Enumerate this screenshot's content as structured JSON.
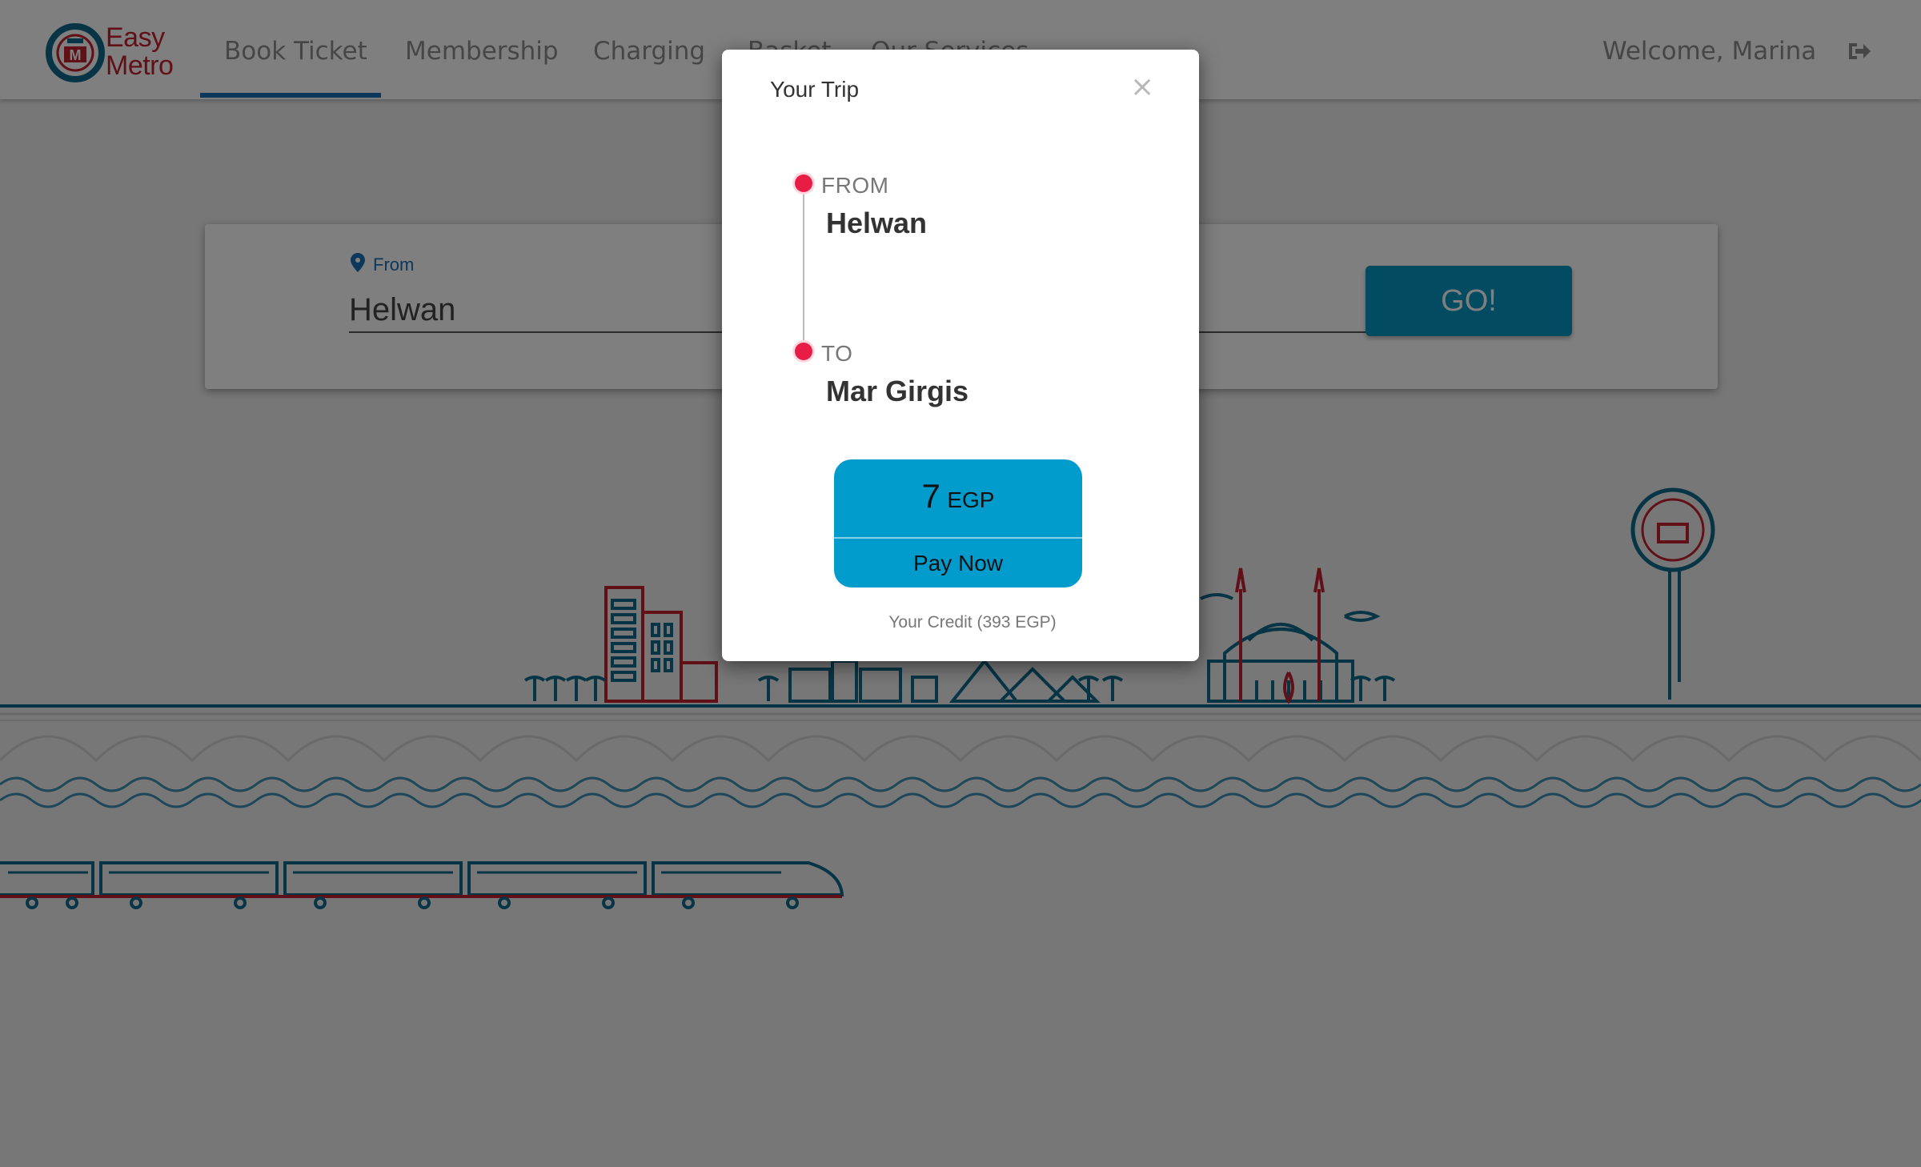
{
  "app": {
    "logo_line1": "Easy",
    "logo_line2": "Metro",
    "logo_icon": "metro-logo-icon"
  },
  "nav": {
    "items": [
      {
        "label": "Book Ticket",
        "active": true
      },
      {
        "label": "Membership",
        "active": false
      },
      {
        "label": "Charging",
        "active": false
      },
      {
        "label": "Basket",
        "active": false
      },
      {
        "label": "Our Services",
        "active": false
      }
    ],
    "welcome": "Welcome, Marina",
    "logout_icon": "sign-out-icon"
  },
  "search": {
    "from_label": "From",
    "from_value": "Helwan",
    "go_label": "GO!"
  },
  "modal": {
    "title": "Your Trip",
    "close_symbol": "×",
    "from_tag": "FROM",
    "from_station": "Helwan",
    "to_tag": "TO",
    "to_station": "Mar Girgis",
    "fare_value": "7",
    "fare_currency": "EGP",
    "pay_label": "Pay Now",
    "credit_text": "Your Credit (393 EGP)"
  },
  "colors": {
    "brand_red": "#c3202f",
    "brand_blue": "#1a6fb6",
    "go_button": "#0797c2",
    "fare_box": "#029ccc",
    "stop_dot": "#e81d46"
  }
}
